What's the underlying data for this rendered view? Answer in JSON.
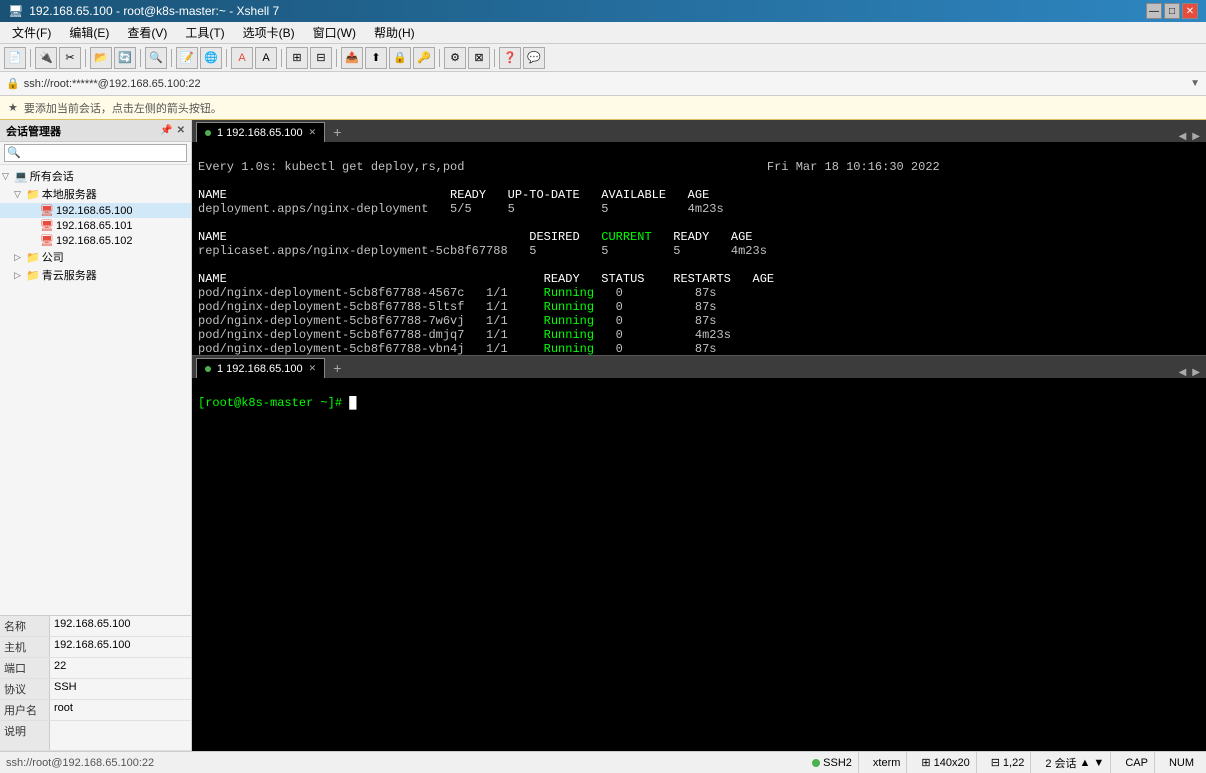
{
  "window": {
    "title": "192.168.65.100 - root@k8s-master:~ - Xshell 7",
    "minimize_label": "—",
    "maximize_label": "□",
    "close_label": "✕"
  },
  "menubar": {
    "items": [
      "文件(F)",
      "编辑(E)",
      "查看(V)",
      "工具(T)",
      "选项卡(B)",
      "窗口(W)",
      "帮助(H)"
    ]
  },
  "address_bar": {
    "icon": "🔒",
    "text": "ssh://root:******@192.168.65.100:22",
    "arrow": "▼"
  },
  "hint_bar": {
    "icon": "★",
    "text": "要添加当前会话，点击左侧的箭头按钮。"
  },
  "sidebar": {
    "title": "会话管理器",
    "pin_label": "📌",
    "close_label": "✕",
    "tree": [
      {
        "level": 0,
        "expand": "▽",
        "icon": "💻",
        "label": "所有会话",
        "type": "root"
      },
      {
        "level": 1,
        "expand": "▽",
        "icon": "📁",
        "label": "本地服务器",
        "type": "folder"
      },
      {
        "level": 2,
        "expand": " ",
        "icon": "🖥",
        "label": "192.168.65.100",
        "color": "#e74c3c",
        "type": "server"
      },
      {
        "level": 2,
        "expand": " ",
        "icon": "🖥",
        "label": "192.168.65.101",
        "color": "#e74c3c",
        "type": "server"
      },
      {
        "level": 2,
        "expand": " ",
        "icon": "🖥",
        "label": "192.168.65.102",
        "color": "#e74c3c",
        "type": "server"
      },
      {
        "level": 1,
        "expand": "▷",
        "icon": "📁",
        "label": "公司",
        "type": "folder"
      },
      {
        "level": 1,
        "expand": "▷",
        "icon": "📁",
        "label": "青云服务器",
        "type": "folder"
      }
    ],
    "info": [
      {
        "key": "名称",
        "val": "192.168.65.100"
      },
      {
        "key": "主机",
        "val": "192.168.65.100"
      },
      {
        "key": "端口",
        "val": "22"
      },
      {
        "key": "协议",
        "val": "SSH"
      },
      {
        "key": "用户名",
        "val": "root"
      },
      {
        "key": "说明",
        "val": ""
      }
    ]
  },
  "tabs_upper": {
    "tabs": [
      {
        "label": "1 192.168.65.100",
        "active": true,
        "dot": true
      }
    ],
    "add_label": "+",
    "nav_left": "◀",
    "nav_right": "▶"
  },
  "tabs_lower": {
    "tabs": [
      {
        "label": "1 192.168.65.100",
        "active": true,
        "dot": true
      }
    ],
    "add_label": "+",
    "nav_left": "◀",
    "nav_right": "▶"
  },
  "terminal_upper": {
    "line1": "Every 1.0s: kubectl get deploy,rs,pod                                          Fri Mar 18 10:16:30 2022",
    "section1_header": "NAME                               READY   UP-TO-DATE   AVAILABLE   AGE",
    "section1_row": "deployment.apps/nginx-deployment   5/5     5            5           4m23s",
    "section2_header": "NAME                                          DESIRED   CURRENT   READY   AGE",
    "section2_row": "replicaset.apps/nginx-deployment-5cb8f67788   5         5         5       4m23s",
    "section3_header": "NAME                                            READY   STATUS    RESTARTS   AGE",
    "section3_rows": [
      "pod/nginx-deployment-5cb8f67788-4567c   1/1     Running   0          87s",
      "pod/nginx-deployment-5cb8f67788-5ltsf   1/1     Running   0          87s",
      "pod/nginx-deployment-5cb8f67788-7w6vj   1/1     Running   0          87s",
      "pod/nginx-deployment-5cb8f67788-dmjq7   1/1     Running   0          4m23s",
      "pod/nginx-deployment-5cb8f67788-vbn4j   1/1     Running   0          87s"
    ]
  },
  "terminal_lower": {
    "prompt": "[root@k8s-master ~]# "
  },
  "statusbar": {
    "ssh_label": "SSH2",
    "term_label": "xterm",
    "size_icon": "⊞",
    "size_label": "140x20",
    "pos_icon": "⊟",
    "pos_label": "1,22",
    "sessions_label": "2 会话",
    "up_arrow": "▲",
    "down_arrow": "▼",
    "caps_label": "CAP",
    "num_label": "NUM"
  }
}
